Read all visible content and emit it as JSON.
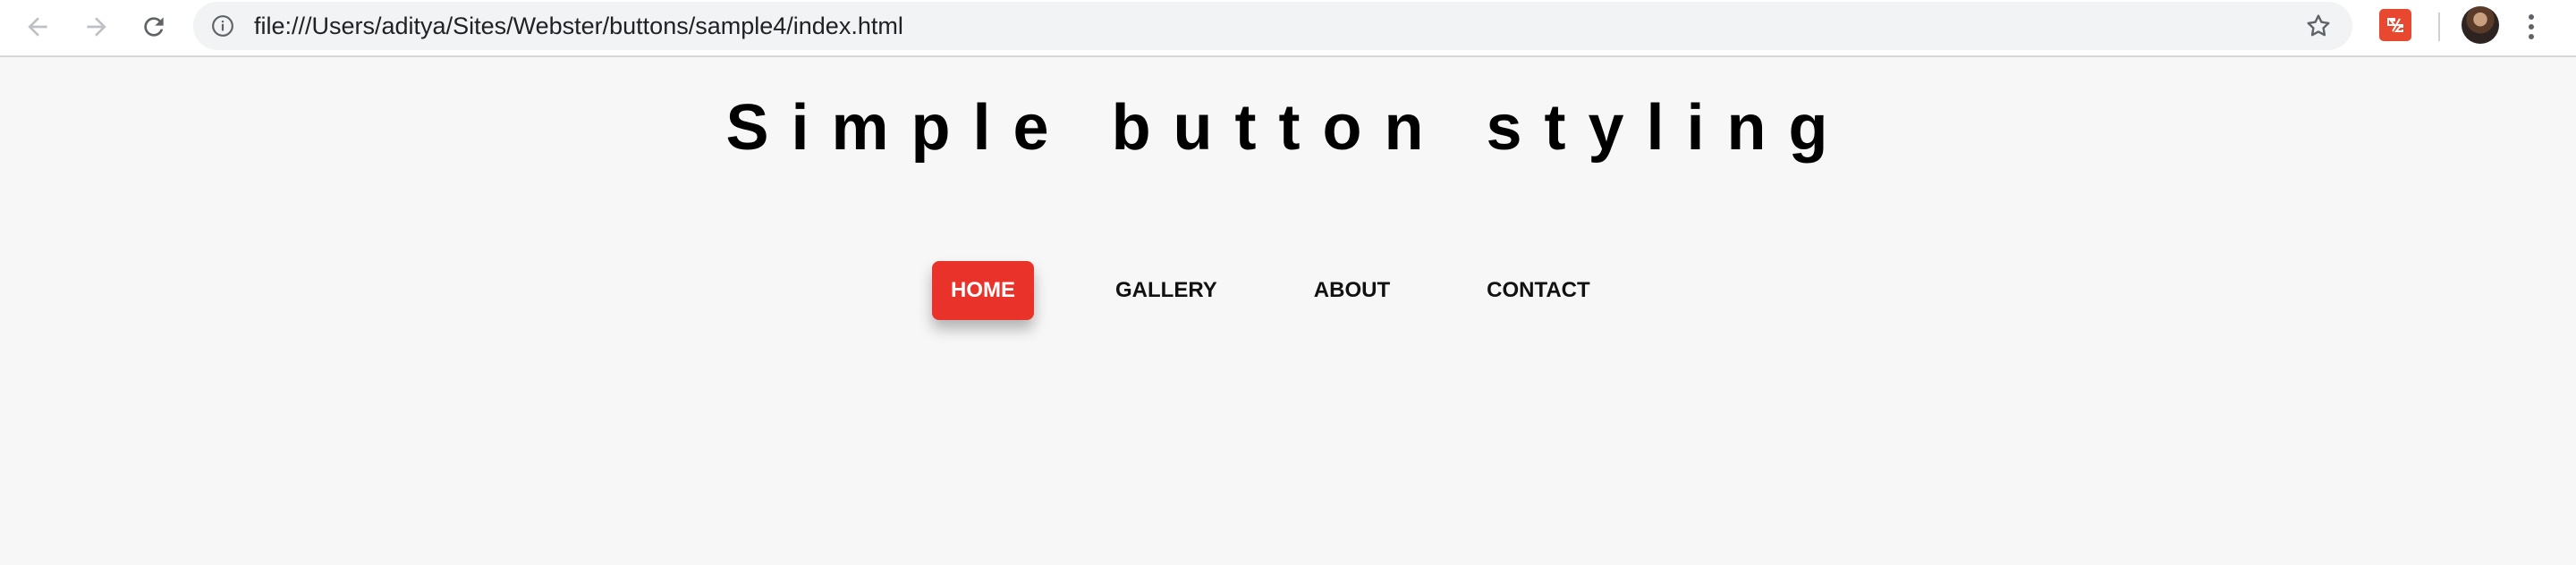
{
  "browser": {
    "url": "file:///Users/aditya/Sites/Webster/buttons/sample4/index.html",
    "icons": {
      "back": "back-arrow-icon",
      "forward": "forward-arrow-icon",
      "reload": "reload-icon",
      "info": "info-icon",
      "bookmark": "star-icon",
      "extension": "extension-icon",
      "profile": "avatar",
      "menu": "kebab-menu-icon"
    }
  },
  "page": {
    "title": "Simple button styling",
    "nav": [
      {
        "label": "HOME",
        "active": true
      },
      {
        "label": "GALLERY",
        "active": false
      },
      {
        "label": "ABOUT",
        "active": false
      },
      {
        "label": "CONTACT",
        "active": false
      }
    ]
  },
  "colors": {
    "accent": "#e9332a",
    "background": "#f7f7f7",
    "text": "#111111"
  }
}
